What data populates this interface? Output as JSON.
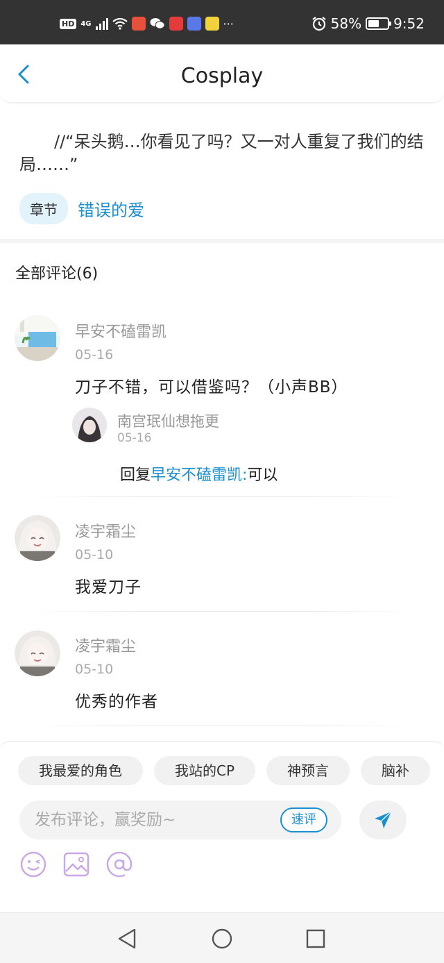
{
  "status_bar": {
    "hd": "HD",
    "network": "4G",
    "more": "···",
    "battery": "58%",
    "battery_level": 0.58,
    "time": "9:52",
    "icons": [
      "signal-icon",
      "wifi-icon",
      "app-icon",
      "wechat-icon",
      "shop-618-icon",
      "music-icon",
      "app-100-icon",
      "alarm-icon",
      "battery-icon"
    ]
  },
  "header": {
    "title": "Cosplay",
    "back_icon": "chevron-left-icon"
  },
  "post": {
    "quote": "//“呆头鹅…你看见了吗？又一对人重复了我们的结局……”",
    "chapter_tag": "章节",
    "chapter_name": "错误的爱"
  },
  "comments_title": "全部评论(6)",
  "comments": [
    {
      "name": "早安不磕雷凯",
      "date": "05-16",
      "text": "刀子不错，可以借鉴吗？（小声BB）",
      "reply": {
        "name": "南宫珉仙想拖更",
        "date": "05-16",
        "prefix": "回复",
        "target": "早安不磕雷凯:",
        "text": "可以"
      }
    },
    {
      "name": "凌宇霜尘",
      "date": "05-10",
      "text": "我爱刀子"
    },
    {
      "name": "凌宇霜尘",
      "date": "05-10",
      "text": "优秀的作者"
    }
  ],
  "composer": {
    "chips": [
      "我最爱的角色",
      "我站的CP",
      "神预言",
      "脑补"
    ],
    "placeholder": "发布评论，赢奖励~",
    "quick_label": "速评",
    "send_icon": "send-icon",
    "tools": [
      "emoji-icon",
      "image-icon",
      "mention-icon"
    ]
  },
  "navbar": {
    "icons": [
      "back-triangle-icon",
      "home-circle-icon",
      "recents-square-icon"
    ]
  },
  "colors": {
    "accent": "#1a8fd0",
    "tool_purple": "#c9a6e6",
    "status_bar": "#333333"
  }
}
